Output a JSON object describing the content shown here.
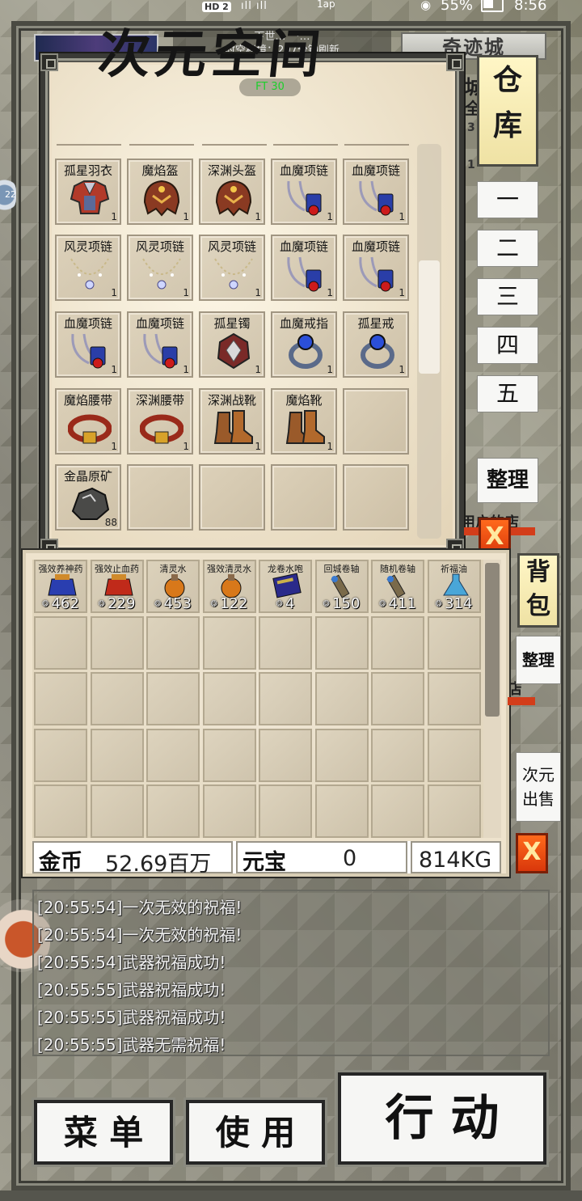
{
  "status_bar": {
    "hd": "HD 2",
    "signal": "ıll ıll",
    "network": "1ap",
    "battery": "55%",
    "time": "8:56"
  },
  "background": {
    "top_info_line1": "下世…　·…",
    "top_info_line2": "时空秘境：297分钟刷新",
    "city": "奇迹城",
    "behind_labels": [
      "城",
      "全",
      "3",
      "1",
      "用户的店",
      "店"
    ]
  },
  "warehouse": {
    "title": "次元空间",
    "title_overlay": "FT 30",
    "slots": [
      {
        "name": "孤星羽衣",
        "qty": "1",
        "icon": "armor-icon"
      },
      {
        "name": "魔焰盔",
        "qty": "1",
        "icon": "helmet-icon"
      },
      {
        "name": "深渊头盔",
        "qty": "1",
        "icon": "helmet-icon"
      },
      {
        "name": "血魔项链",
        "qty": "1",
        "icon": "necklace-red-icon"
      },
      {
        "name": "血魔项链",
        "qty": "1",
        "icon": "necklace-red-icon"
      },
      {
        "name": "风灵项链",
        "qty": "1",
        "icon": "necklace-pearl-icon"
      },
      {
        "name": "风灵项链",
        "qty": "1",
        "icon": "necklace-pearl-icon"
      },
      {
        "name": "风灵项链",
        "qty": "1",
        "icon": "necklace-pearl-icon"
      },
      {
        "name": "血魔项链",
        "qty": "1",
        "icon": "necklace-red-icon"
      },
      {
        "name": "血魔项链",
        "qty": "1",
        "icon": "necklace-red-icon"
      },
      {
        "name": "血魔项链",
        "qty": "1",
        "icon": "necklace-red-icon"
      },
      {
        "name": "血魔项链",
        "qty": "1",
        "icon": "necklace-red-icon"
      },
      {
        "name": "孤星镯",
        "qty": "1",
        "icon": "bracelet-icon"
      },
      {
        "name": "血魔戒指",
        "qty": "1",
        "icon": "ring-icon"
      },
      {
        "name": "孤星戒",
        "qty": "1",
        "icon": "ring-icon"
      },
      {
        "name": "魔焰腰带",
        "qty": "1",
        "icon": "belt-icon"
      },
      {
        "name": "深渊腰带",
        "qty": "1",
        "icon": "belt-icon"
      },
      {
        "name": "深渊战靴",
        "qty": "1",
        "icon": "boots-icon"
      },
      {
        "name": "魔焰靴",
        "qty": "1",
        "icon": "boots-icon"
      },
      {
        "name": "",
        "qty": "",
        "icon": ""
      },
      {
        "name": "金晶原矿",
        "qty": "88",
        "icon": "ore-icon"
      },
      {
        "name": "",
        "qty": "",
        "icon": ""
      },
      {
        "name": "",
        "qty": "",
        "icon": ""
      },
      {
        "name": "",
        "qty": "",
        "icon": ""
      },
      {
        "name": "",
        "qty": "",
        "icon": ""
      }
    ]
  },
  "side_tabs": {
    "warehouse_tab": "仓库",
    "pages": [
      "一",
      "二",
      "三",
      "四",
      "五"
    ],
    "tidy_warehouse": "整理",
    "close": "X",
    "bag_tab": "背包",
    "tidy_bag": "整理",
    "sell": "次元出售"
  },
  "bag": {
    "items": [
      {
        "name": "强效养神药",
        "qty": "462",
        "icon": "potion-blue-icon"
      },
      {
        "name": "强效止血药",
        "qty": "229",
        "icon": "potion-red-icon"
      },
      {
        "name": "清灵水",
        "qty": "453",
        "icon": "potion-orange-icon"
      },
      {
        "name": "强效清灵水",
        "qty": "122",
        "icon": "potion-orange-icon"
      },
      {
        "name": "龙卷水咆",
        "qty": "4",
        "icon": "book-icon"
      },
      {
        "name": "回城卷轴",
        "qty": "150",
        "icon": "scroll-icon"
      },
      {
        "name": "随机卷轴",
        "qty": "411",
        "icon": "scroll-icon"
      },
      {
        "name": "祈福油",
        "qty": "314",
        "icon": "flask-icon"
      }
    ],
    "gold_label": "金币",
    "gold_value": "52.69百万",
    "yuanbao_label": "元宝",
    "yuanbao_value": "0",
    "weight": "814KG"
  },
  "chat": [
    "[20:55:54]一次无效的祝福!",
    "[20:55:54]一次无效的祝福!",
    "[20:55:54]武器祝福成功!",
    "[20:55:55]武器祝福成功!",
    "[20:55:55]武器祝福成功!",
    "[20:55:55]武器无需祝福!"
  ],
  "side_orb_label": "22",
  "bottom": {
    "menu": "菜 单",
    "use": "使 用",
    "action": "行 动"
  },
  "colors": {
    "panel": "#ecdfc7",
    "tab_gold": "#fff6c6",
    "close_orange": "#e84a12",
    "chat_text": "#f2f2f2"
  }
}
